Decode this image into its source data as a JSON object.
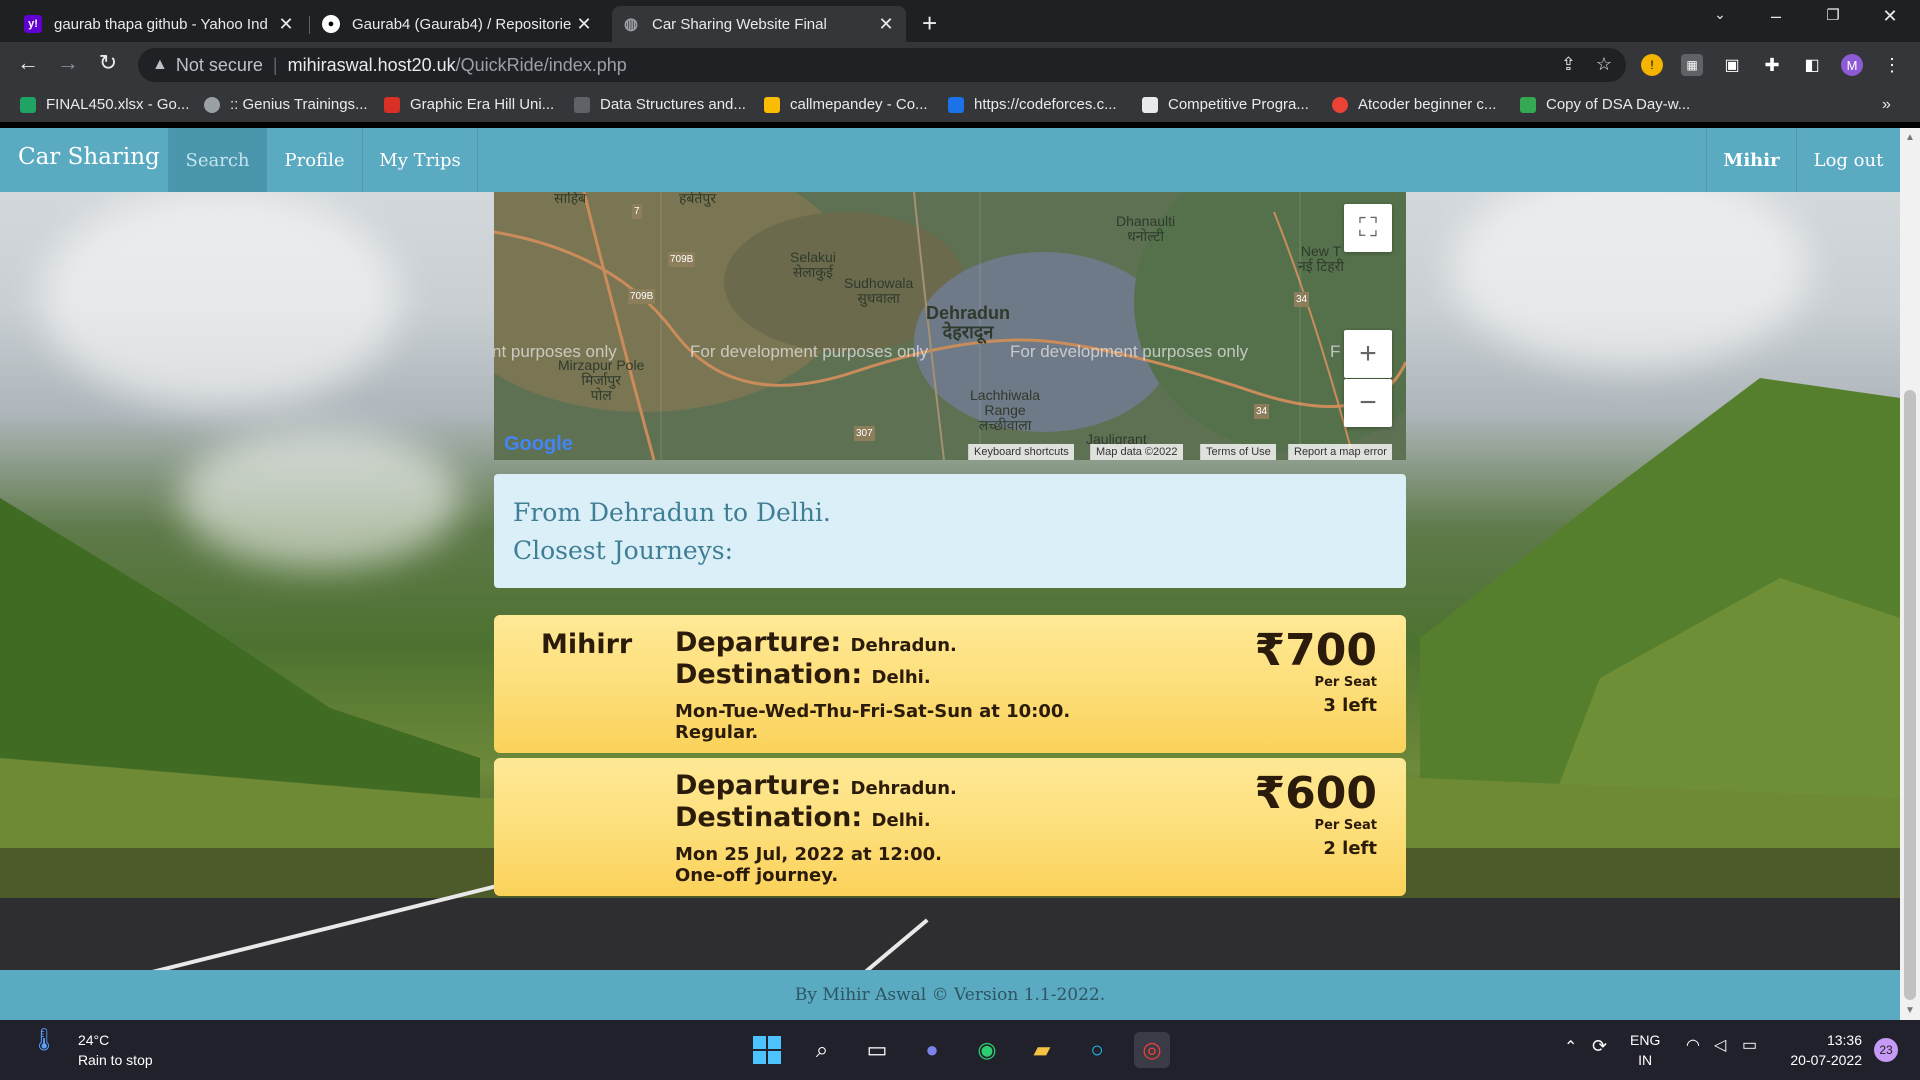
{
  "browser": {
    "tabs": [
      {
        "title": "gaurab thapa github - Yahoo Ind",
        "favicon": "yahoo-icon",
        "color": "#6001d2"
      },
      {
        "title": "Gaurab4 (Gaurab4) / Repositorie",
        "favicon": "github-icon",
        "color": "#ffffff"
      },
      {
        "title": "Car Sharing Website Final",
        "favicon": "globe-icon",
        "color": "#9aa0a6"
      }
    ],
    "address": {
      "security": "Not secure",
      "host": "mihiraswal.host20.uk",
      "path": "/QuickRide/index.php"
    },
    "bookmarks": [
      {
        "label": "FINAL450.xlsx - Go...",
        "color": "#1fa463"
      },
      {
        "label": ":: Genius Trainings...",
        "color": "#9aa0a6"
      },
      {
        "label": "Graphic Era Hill Uni...",
        "color": "#d93025"
      },
      {
        "label": "Data Structures and...",
        "color": "#5f6368"
      },
      {
        "label": "callmepandey - Co...",
        "color": "#fbbc04"
      },
      {
        "label": "https://codeforces.c...",
        "color": "#1a73e8"
      },
      {
        "label": "Competitive Progra...",
        "color": "#e8eaed"
      },
      {
        "label": "Atcoder beginner c...",
        "color": "#ea4335"
      },
      {
        "label": "Copy of DSA Day-w...",
        "color": "#34a853"
      }
    ],
    "profile_initial": "M"
  },
  "site": {
    "brand": "Car Sharing",
    "nav": {
      "search": "Search",
      "profile": "Profile",
      "trips": "My Trips",
      "user": "Mihir",
      "logout": "Log out"
    },
    "map": {
      "dev_text": "For development purposes only",
      "dev_partial_left": "nt purposes only",
      "dev_partial_right": "F",
      "labels": {
        "dehradun": "Dehradun",
        "dehradun_hi": "देहरादून",
        "selakui": "Selakui",
        "selakui_hi": "सेलाकुई",
        "sudhowala": "Sudhowala",
        "sudhowala_hi": "सुधवाला",
        "dhanaulti": "Dhanaulti",
        "dhanaulti_hi": "धनोल्टी",
        "newt": "New T",
        "newt_hi": "नई टिहरी",
        "mirzapur": "Mirzapur Pole",
        "mirzapur_hi": "मिर्जापुर",
        "mirzapur_hi2": "पोल",
        "lachhiwala": "Lachhiwala",
        "lachhiwala2": "Range",
        "lachhiwala_hi": "लच्छीवाला",
        "harbatpur": "हर्बर्तपुर",
        "sahib": "साहिब",
        "jaulig": "Jauligrant",
        "r7": "7",
        "r709b": "709B",
        "r709b2": "709B",
        "r307": "307",
        "r34": "34",
        "r34b": "34"
      },
      "google": "Google",
      "footer": {
        "shortcuts": "Keyboard shortcuts",
        "data": "Map data ©2022",
        "terms": "Terms of Use",
        "report": "Report a map error"
      }
    },
    "info": {
      "line1": "From Dehradun to Delhi.",
      "line2": "Closest Journeys:"
    },
    "trips": [
      {
        "driver": "Mihirr",
        "dep_label": "Departure:",
        "departure": "Dehradun.",
        "dest_label": "Destination:",
        "destination": "Delhi.",
        "schedule": "Mon-Tue-Wed-Thu-Fri-Sat-Sun at 10:00.",
        "type": "Regular.",
        "price": "₹700",
        "per_seat": "Per Seat",
        "left": "3 left"
      },
      {
        "driver": "",
        "dep_label": "Departure:",
        "departure": "Dehradun.",
        "dest_label": "Destination:",
        "destination": "Delhi.",
        "schedule": "Mon 25 Jul, 2022 at 12:00.",
        "type": "One-off journey.",
        "price": "₹600",
        "per_seat": "Per Seat",
        "left": "2 left"
      }
    ],
    "footer": "By Mihir Aswal © Version 1.1-2022."
  },
  "taskbar": {
    "weather": {
      "temp": "24°C",
      "desc": "Rain to stop"
    },
    "lang": {
      "line1": "ENG",
      "line2": "IN"
    },
    "clock": {
      "time": "13:36",
      "date": "20-07-2022"
    },
    "notifications": "23"
  }
}
